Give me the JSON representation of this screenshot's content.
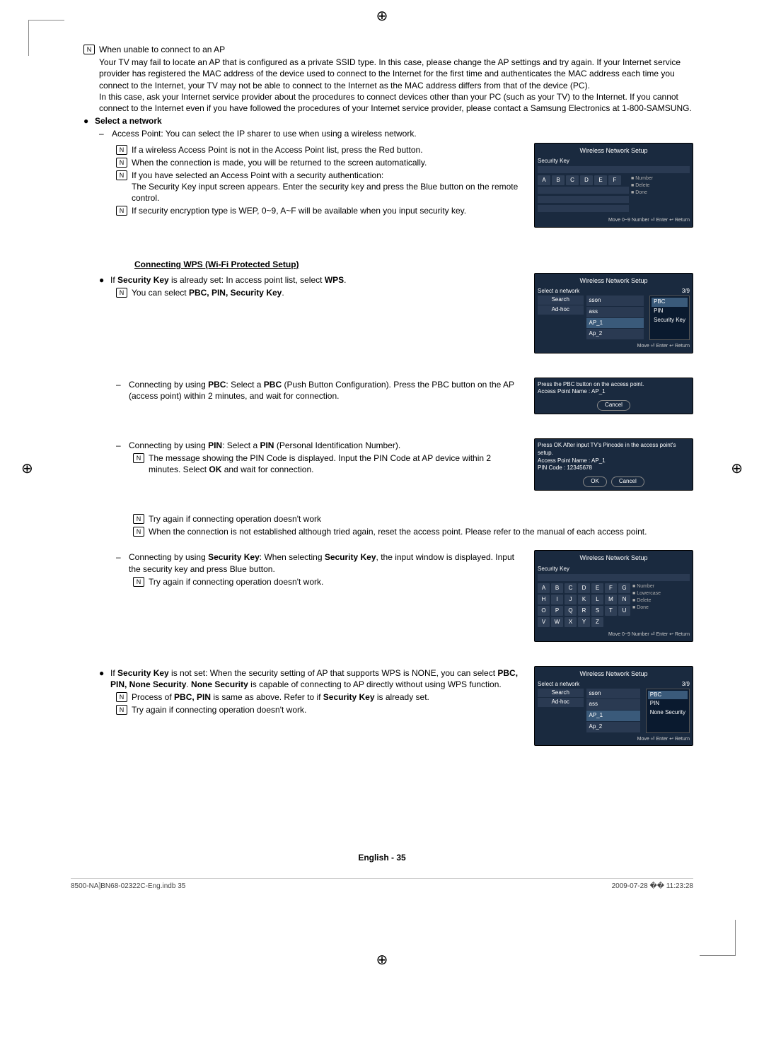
{
  "reg": "⊕",
  "s1": {
    "noteicon": "N",
    "title": "When unable to connect to an AP",
    "p1": "Your TV may fail to locate an AP that is configured as a private SSID type. In this case, please change the AP settings and try again. If your Internet service provider has registered the MAC address of the device used to connect to the Internet for the first time and authenticates the MAC address each time you connect to the Internet, your TV may not be able to connect to the Internet as the MAC address differs from that of the device (PC).",
    "p2": "In this case, ask your Internet service provider about the procedures to connect devices other than your PC (such as your TV) to the Internet. If you cannot connect to the Internet even if you have followed the procedures of your Internet service provider, please contact a Samsung Electronics at 1-800-SAMSUNG."
  },
  "s2": {
    "head": "Select a network",
    "i1": "Access Point: You can select the IP sharer to use when using a wireless network.",
    "i2": "If a wireless Access Point is not in the Access Point list, press the Red button.",
    "i3": "When the connection is made, you will be returned to the screen automatically.",
    "i4": "If you have selected an Access Point with a security authentication:",
    "i4b": "The Security Key input screen appears. Enter the security key and press the Blue button on the remote control.",
    "i5": "If security encryption type is WEP, 0~9, A~F will be available when you input security key."
  },
  "wps": {
    "head": "Connecting WPS (Wi-Fi Protected Setup)",
    "l1a": "If ",
    "l1b": "Security Key",
    "l1c": " is already set: In access point list, select ",
    "l1d": "WPS",
    "l1e": ".",
    "l2a": "You can select ",
    "l2b": "PBC, PIN, Security Key",
    "l2c": ".",
    "pbc1": "Connecting by using ",
    "pbc2": "PBC",
    "pbc3": ": Select a ",
    "pbc4": "PBC",
    "pbc5": " (Push Button Configuration). Press the PBC button on the AP (access point) within 2 minutes, and wait for connection.",
    "pin1": "Connecting by using ",
    "pin2": "PIN",
    "pin3": ": Select a ",
    "pin4": "PIN",
    "pin5": " (Personal Identification Number).",
    "pin6": "The message showing the PIN Code is displayed. Input the PIN Code at AP device within 2 minutes. Select ",
    "pin7": "OK",
    "pin8": " and wait for connection.",
    "pin9": "Try again if connecting operation doesn't work",
    "pin10": "When the connection is not established although tried again, reset the access point. Please refer to the manual of each access point.",
    "sk1": "Connecting by using ",
    "sk2": "Security Key",
    "sk3": ": When selecting ",
    "sk4": "Security Key",
    "sk5": ", the input window is displayed. Input the security key and press Blue button.",
    "sk6": "Try again if connecting operation doesn't work.",
    "ns1": "If ",
    "ns2": "Security Key",
    "ns3": " is not set: When the security setting of AP that supports WPS is NONE, you can select ",
    "ns4": "PBC, PIN, None Security",
    "ns5": ". ",
    "ns6": "None Security",
    "ns7": " is capable of connecting to AP directly without using WPS function.",
    "ns8": "Process of ",
    "ns9": "PBC, PIN",
    "ns10": " is same as above. Refer to if ",
    "ns11": "Security Key",
    "ns12": " is already set.",
    "ns13": "Try again if connecting operation doesn't work."
  },
  "pop1": {
    "title": "Wireless Network Setup",
    "label": "Security Key",
    "keys": [
      "A",
      "B",
      "C",
      "D",
      "E",
      "F"
    ],
    "legend1": "Number",
    "legend2": "Delete",
    "legend3": "Done",
    "foot": "Move    0~9 Number    ⏎ Enter    ↩ Return"
  },
  "pop2": {
    "title": "Wireless Network Setup",
    "label": "Select a network",
    "count": "3/9",
    "items": [
      "sson",
      "ass",
      "AP_1",
      "Ap_2"
    ],
    "btn1": "Search",
    "btn2": "Ad-hoc",
    "menu": [
      "PBC",
      "PIN",
      "Security Key"
    ],
    "foot": "Move    ⏎ Enter    ↩ Return"
  },
  "pop3": {
    "msg": "Press the PBC button on the access point.",
    "ap": "Access Point Name : AP_1",
    "cancel": "Cancel"
  },
  "pop4": {
    "msg": "Press OK After input TV's Pincode in the access point's setup.",
    "ap": "Access Point Name : AP_1",
    "pin": "PIN Code : 12345678",
    "ok": "OK",
    "cancel": "Cancel"
  },
  "pop5": {
    "title": "Wireless Network Setup",
    "label": "Security Key",
    "r1": [
      "A",
      "B",
      "C",
      "D",
      "E",
      "F",
      "G"
    ],
    "r2": [
      "H",
      "I",
      "J",
      "K",
      "L",
      "M",
      "N"
    ],
    "r3": [
      "O",
      "P",
      "Q",
      "R",
      "S",
      "T",
      "U"
    ],
    "r4": [
      "V",
      "W",
      "X",
      "Y",
      "Z"
    ],
    "legend": [
      "Number",
      "Lowercase",
      "Delete",
      "Done"
    ],
    "foot": "Move    0~9 Number    ⏎ Enter    ↩ Return"
  },
  "pop6": {
    "title": "Wireless Network Setup",
    "label": "Select a network",
    "count": "3/9",
    "items": [
      "sson",
      "ass",
      "AP_1",
      "Ap_2"
    ],
    "btn1": "Search",
    "btn2": "Ad-hoc",
    "menu": [
      "PBC",
      "PIN",
      "None Security"
    ],
    "foot": "Move    ⏎ Enter    ↩ Return"
  },
  "footer": {
    "lang": "English - 35",
    "left": "8500-NA]BN68-02322C-Eng.indb   35",
    "right": "2009-07-28   �� 11:23:28"
  }
}
